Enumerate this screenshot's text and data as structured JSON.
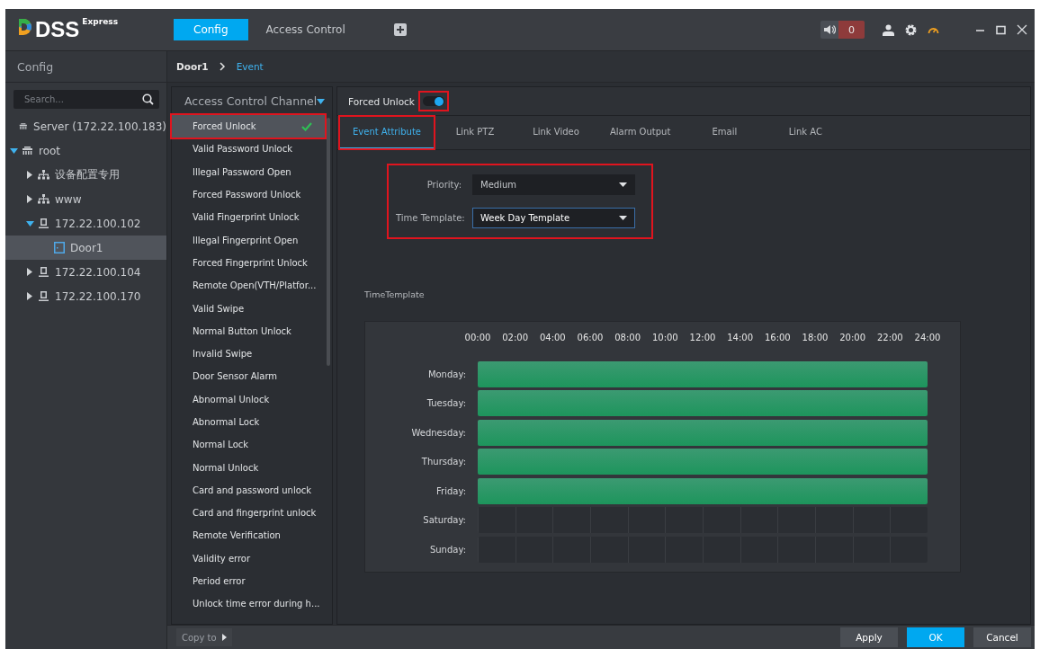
{
  "app": {
    "logo": "DSS",
    "logo_suffix": "Express"
  },
  "top_tabs": [
    {
      "label": "Config",
      "selected": true
    },
    {
      "label": "Access Control",
      "selected": false
    }
  ],
  "alarm_count": "0",
  "sidebar": {
    "title": "Config",
    "search": {
      "placeholder": "Search..."
    },
    "tree": [
      {
        "label": "Server (172.22.100.183)",
        "kind": "server",
        "selected": false
      },
      {
        "label": "root",
        "kind": "server",
        "expanded": true,
        "selected": false,
        "children": [
          {
            "label": "设备配置专用",
            "kind": "org",
            "expanded": false,
            "selected": false
          },
          {
            "label": "www",
            "kind": "org",
            "expanded": false,
            "selected": false
          },
          {
            "label": "172.22.100.102",
            "kind": "device",
            "expanded": true,
            "selected": false,
            "children": [
              {
                "label": "Door1",
                "kind": "door",
                "selected": true
              }
            ]
          },
          {
            "label": "172.22.100.104",
            "kind": "device",
            "expanded": false,
            "selected": false
          },
          {
            "label": "172.22.100.170",
            "kind": "device",
            "expanded": false,
            "selected": false
          }
        ]
      }
    ]
  },
  "breadcrumb": [
    "Door1",
    "Event"
  ],
  "channels": {
    "title": "Access Control Channel",
    "items": [
      {
        "label": "Forced Unlock",
        "selected": true,
        "checked": true,
        "highlighted": true
      },
      {
        "label": "Valid Password Unlock",
        "selected": false,
        "checked": false,
        "highlighted": false
      },
      {
        "label": "Illegal Password Open",
        "selected": false,
        "checked": false,
        "highlighted": false
      },
      {
        "label": "Forced Password Unlock",
        "selected": false,
        "checked": false,
        "highlighted": false
      },
      {
        "label": "Valid Fingerprint Unlock",
        "selected": false,
        "checked": false,
        "highlighted": false
      },
      {
        "label": "Illegal Fingerprint Open",
        "selected": false,
        "checked": false,
        "highlighted": false
      },
      {
        "label": "Forced Fingerprint Unlock",
        "selected": false,
        "checked": false,
        "highlighted": false
      },
      {
        "label": "Remote Open(VTH/Platfor...",
        "selected": false,
        "checked": false,
        "highlighted": false
      },
      {
        "label": "Valid Swipe",
        "selected": false,
        "checked": false,
        "highlighted": false
      },
      {
        "label": "Normal Button Unlock",
        "selected": false,
        "checked": false,
        "highlighted": false
      },
      {
        "label": "Invalid Swipe",
        "selected": false,
        "checked": false,
        "highlighted": false
      },
      {
        "label": "Door Sensor Alarm",
        "selected": false,
        "checked": false,
        "highlighted": false
      },
      {
        "label": "Abnormal Unlock",
        "selected": false,
        "checked": false,
        "highlighted": false
      },
      {
        "label": "Abnormal Lock",
        "selected": false,
        "checked": false,
        "highlighted": false
      },
      {
        "label": "Normal Lock",
        "selected": false,
        "checked": false,
        "highlighted": false
      },
      {
        "label": "Normal Unlock",
        "selected": false,
        "checked": false,
        "highlighted": false
      },
      {
        "label": "Card and password unlock",
        "selected": false,
        "checked": false,
        "highlighted": false
      },
      {
        "label": "Card and fingerprint unlock",
        "selected": false,
        "checked": false,
        "highlighted": false
      },
      {
        "label": "Remote Verification",
        "selected": false,
        "checked": false,
        "highlighted": false
      },
      {
        "label": "Validity error",
        "selected": false,
        "checked": false,
        "highlighted": false
      },
      {
        "label": "Period error",
        "selected": false,
        "checked": false,
        "highlighted": false
      },
      {
        "label": "Unlock time error during h...",
        "selected": false,
        "checked": false,
        "highlighted": false
      }
    ]
  },
  "event": {
    "label": "Forced Unlock",
    "on": true,
    "toggle_highlighted": true
  },
  "tabs": [
    {
      "label": "Event Attribute",
      "selected": true,
      "highlighted": true
    },
    {
      "label": "Link PTZ",
      "selected": false,
      "highlighted": false
    },
    {
      "label": "Link Video",
      "selected": false,
      "highlighted": false
    },
    {
      "label": "Alarm Output",
      "selected": false,
      "highlighted": false
    },
    {
      "label": "Email",
      "selected": false,
      "highlighted": false
    },
    {
      "label": "Link AC",
      "selected": false,
      "highlighted": false
    }
  ],
  "form": {
    "highlighted": true,
    "fields": [
      {
        "label": "Priority:",
        "value": "Medium",
        "focused": false
      },
      {
        "label": "Time Template:",
        "value": "Week Day Template",
        "focused": true
      }
    ]
  },
  "schedule": {
    "title": "TimeTemplate",
    "ticks": [
      "00:00",
      "02:00",
      "04:00",
      "06:00",
      "08:00",
      "10:00",
      "12:00",
      "14:00",
      "16:00",
      "18:00",
      "20:00",
      "22:00",
      "24:00"
    ],
    "days": [
      {
        "label": "Monday:",
        "active": true
      },
      {
        "label": "Tuesday:",
        "active": true
      },
      {
        "label": "Wednesday:",
        "active": true
      },
      {
        "label": "Thursday:",
        "active": true
      },
      {
        "label": "Friday:",
        "active": true
      },
      {
        "label": "Saturday:",
        "active": false
      },
      {
        "label": "Sunday:",
        "active": false
      }
    ]
  },
  "footer": {
    "copy": "Copy to",
    "buttons": [
      {
        "label": "Apply",
        "kind": "secondary"
      },
      {
        "label": "OK",
        "kind": "primary"
      },
      {
        "label": "Cancel",
        "kind": "secondary"
      }
    ]
  }
}
